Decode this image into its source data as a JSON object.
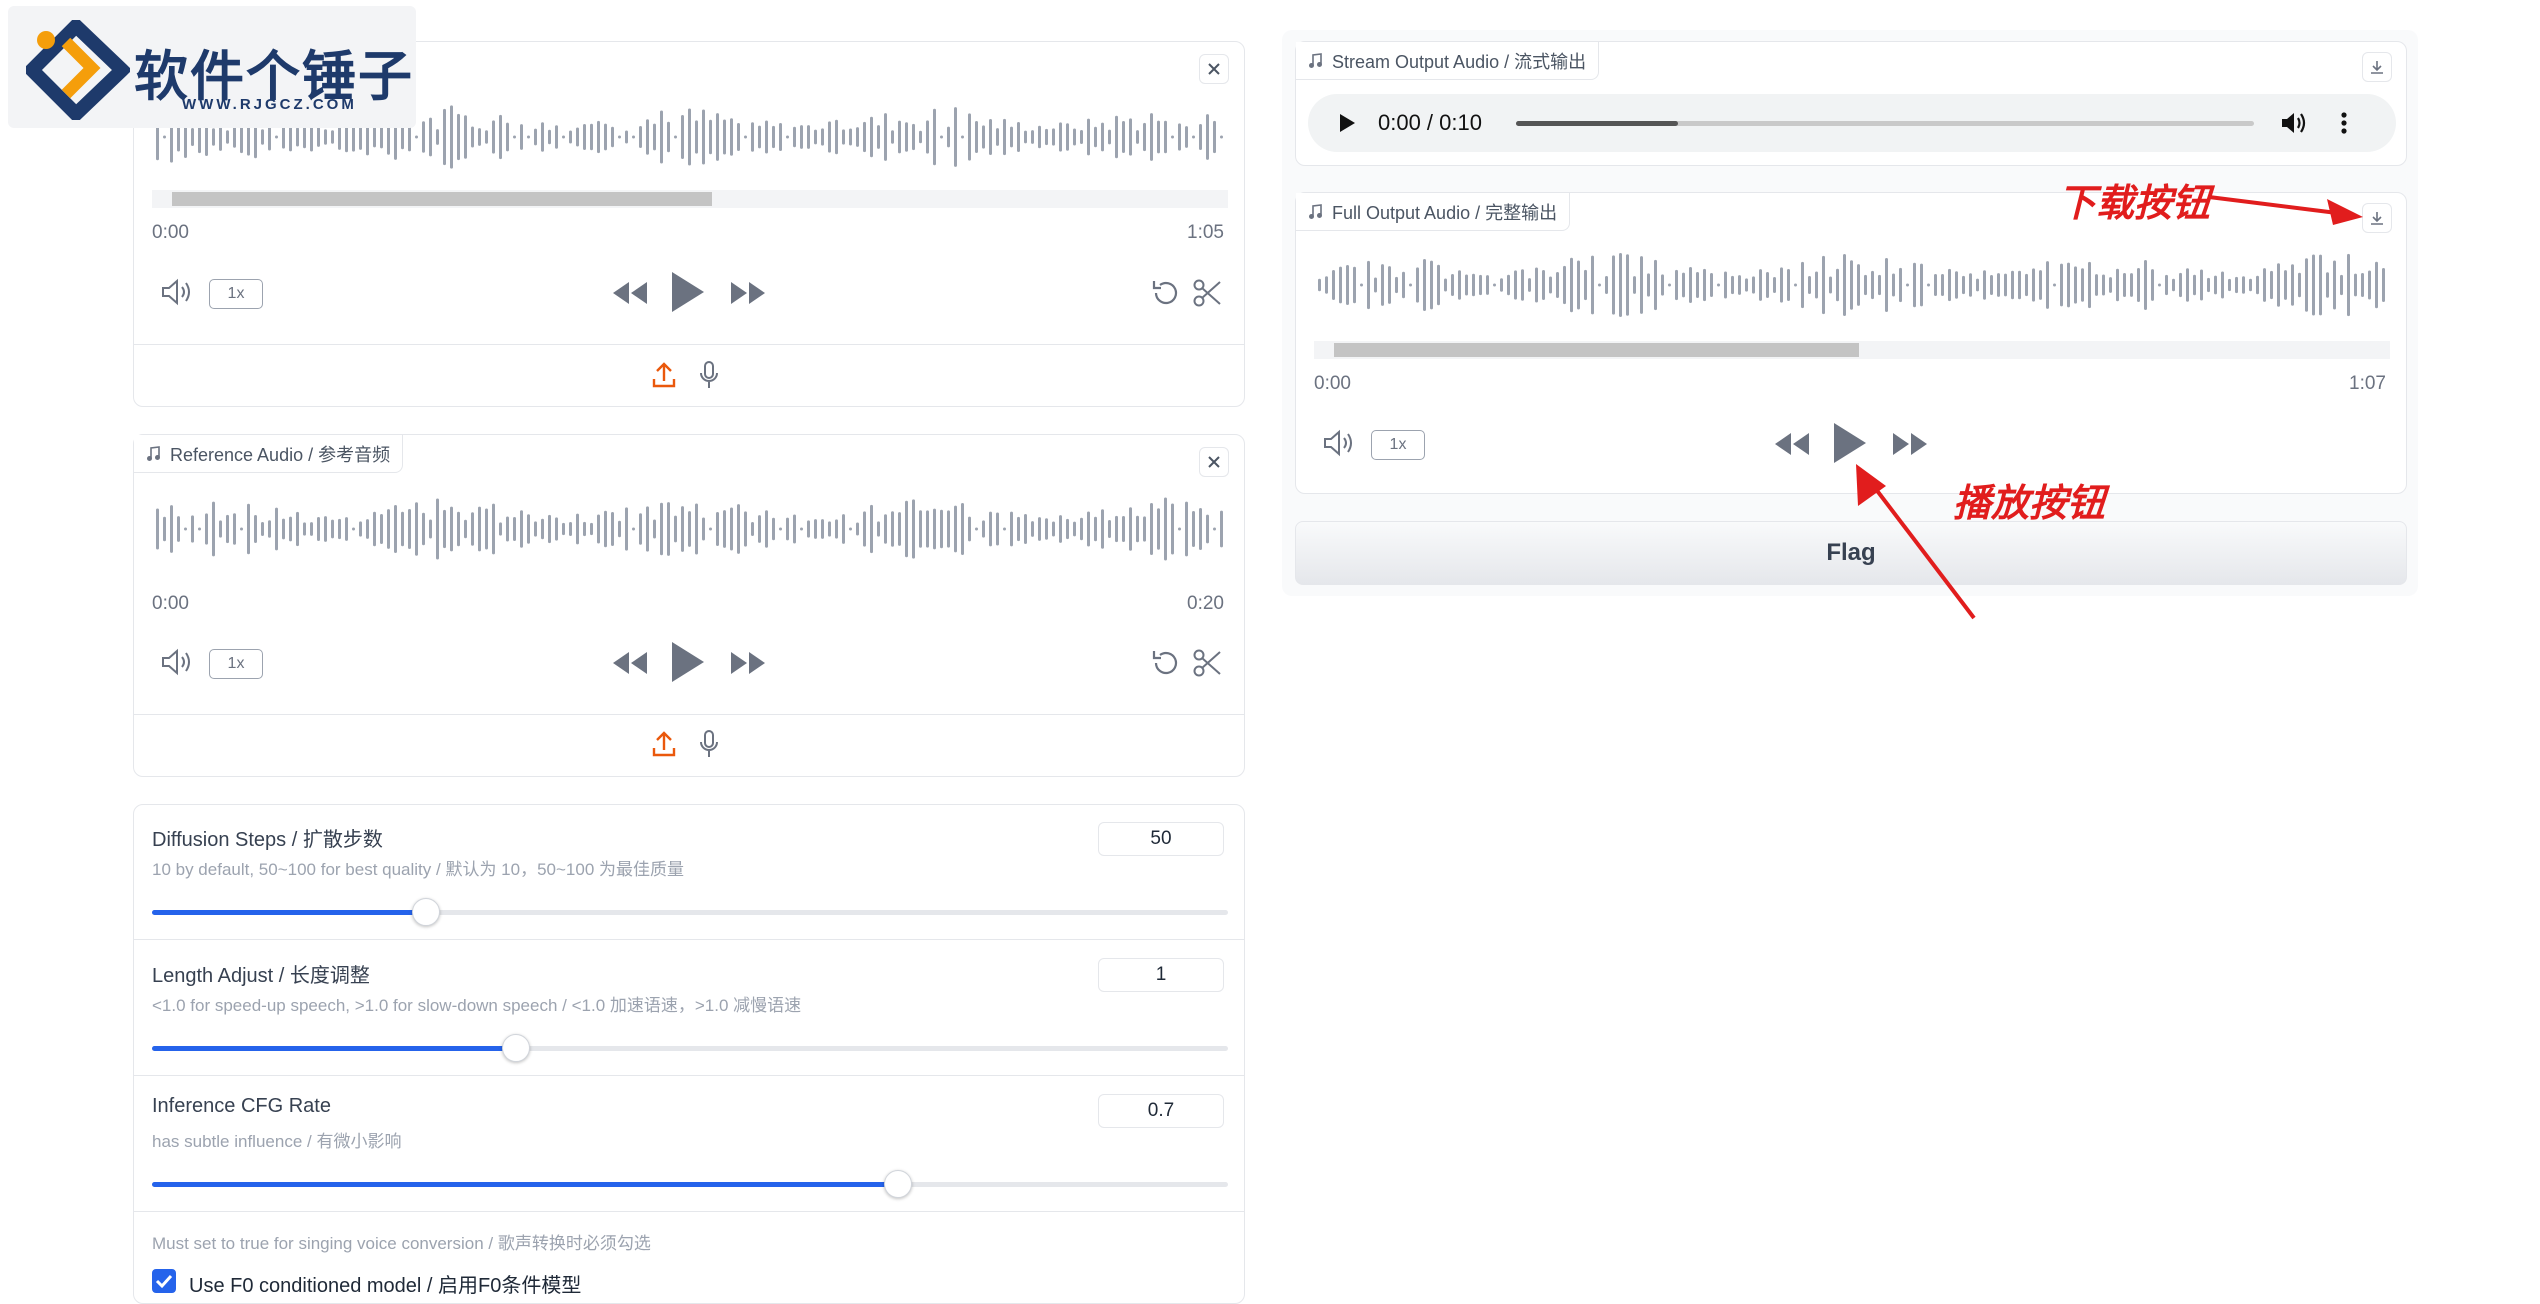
{
  "logo": {
    "brand_text": "软件个锤子",
    "url_text": "WWW.RJGCZ.COM"
  },
  "source_audio": {
    "time_start": "0:00",
    "time_end": "1:05",
    "rate": "1x"
  },
  "reference_audio": {
    "label": "Reference Audio / 参考音频",
    "time_start": "0:00",
    "time_end": "0:20",
    "rate": "1x"
  },
  "settings": [
    {
      "title": "Diffusion Steps / 扩散步数",
      "desc": "10 by default, 50~100 for best quality / 默认为 10，50~100 为最佳质量",
      "value": "50",
      "fraction": 0.255
    },
    {
      "title": "Length Adjust / 长度调整",
      "desc": "<1.0 for speed-up speech, >1.0 for slow-down speech / <1.0 加速语速，>1.0 减慢语速",
      "value": "1",
      "fraction": 0.338
    },
    {
      "title": "Inference CFG Rate",
      "desc": "has subtle influence / 有微小影响",
      "value": "0.7",
      "fraction": 0.693
    }
  ],
  "f0": {
    "desc": "Must set to true for singing voice conversion / 歌声转换时必须勾选",
    "checkbox_label": "Use F0 conditioned model / 启用F0条件模型",
    "checked": true
  },
  "stream_output": {
    "label": "Stream Output Audio / 流式输出",
    "time_display": "0:00 / 0:10",
    "progress": 0.22
  },
  "full_output": {
    "label": "Full Output Audio / 完整输出",
    "time_start": "0:00",
    "time_end": "1:07",
    "rate": "1x"
  },
  "flag_button": "Flag",
  "annotations": {
    "download": "下载按钮",
    "play": "播放按钮"
  },
  "colors": {
    "accent": "#2563eb",
    "upload": "#ea580c",
    "annotation": "#e11d1d",
    "wave": "#9ca3af"
  }
}
